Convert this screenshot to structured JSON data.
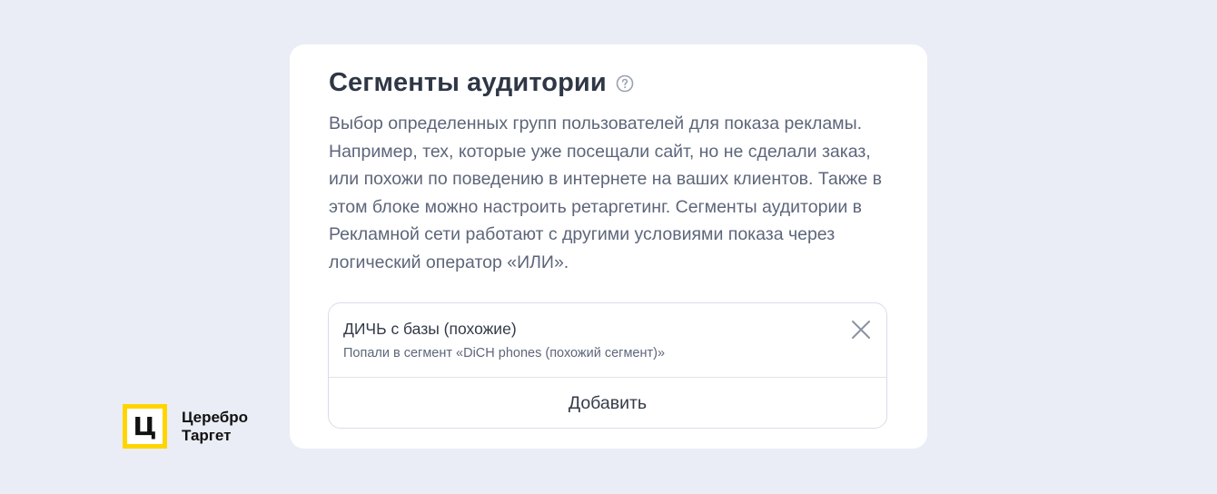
{
  "card": {
    "title": "Сегменты аудитории",
    "help_icon": "question-circle-icon",
    "description": "Выбор определенных групп пользователей для показа рекламы. Например, тех, которые уже посещали сайт, но не сделали заказ, или похожи по поведению в интернете на ваших клиентов. Также в этом блоке можно настроить ретаргетинг. Сегменты аудитории в Рекламной сети работают с другими условиями показа через логический оператор «ИЛИ»."
  },
  "segments": {
    "items": [
      {
        "name": "ДИЧЬ с базы (похожие)",
        "subtitle": "Попали в сегмент «DiCH phones (похожий сегмент)»",
        "remove_icon": "close-icon"
      }
    ],
    "add_label": "Добавить"
  },
  "brand": {
    "logo_letter": "Ц",
    "line1": "Церебро",
    "line2": "Таргет",
    "accent_color": "#ffd500"
  }
}
